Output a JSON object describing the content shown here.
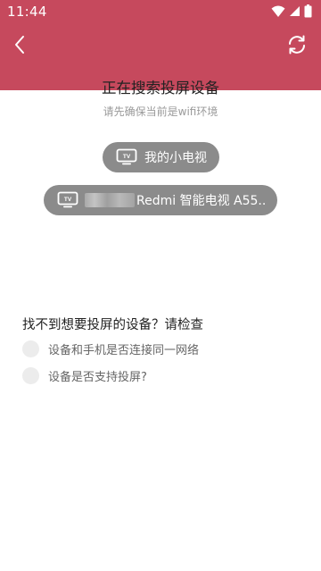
{
  "status_bar": {
    "time": "11:44",
    "icons": [
      "wifi-icon",
      "signal-icon",
      "battery-icon"
    ]
  },
  "toolbar": {
    "back_icon": "chevron-left-icon",
    "refresh_icon": "refresh-icon",
    "background_color": "#c6495d"
  },
  "main": {
    "title": "正在搜索投屏设备",
    "subtitle": "请先确保当前是wifi环境"
  },
  "devices": [
    {
      "icon": "tv-icon",
      "name": "我的小电视"
    },
    {
      "icon": "tv-icon",
      "name": "Redmi 智能电视 A55...",
      "name_prefix_obscured": true
    }
  ],
  "help": {
    "heading": "找不到想要投屏的设备？请检查",
    "items": [
      {
        "text": "设备和手机是否连接同一网络"
      },
      {
        "text": "设备是否支持投屏?"
      }
    ]
  },
  "colors": {
    "accent": "#c6495d",
    "pill": "#8b8b8b",
    "bullet": "#ececec"
  }
}
